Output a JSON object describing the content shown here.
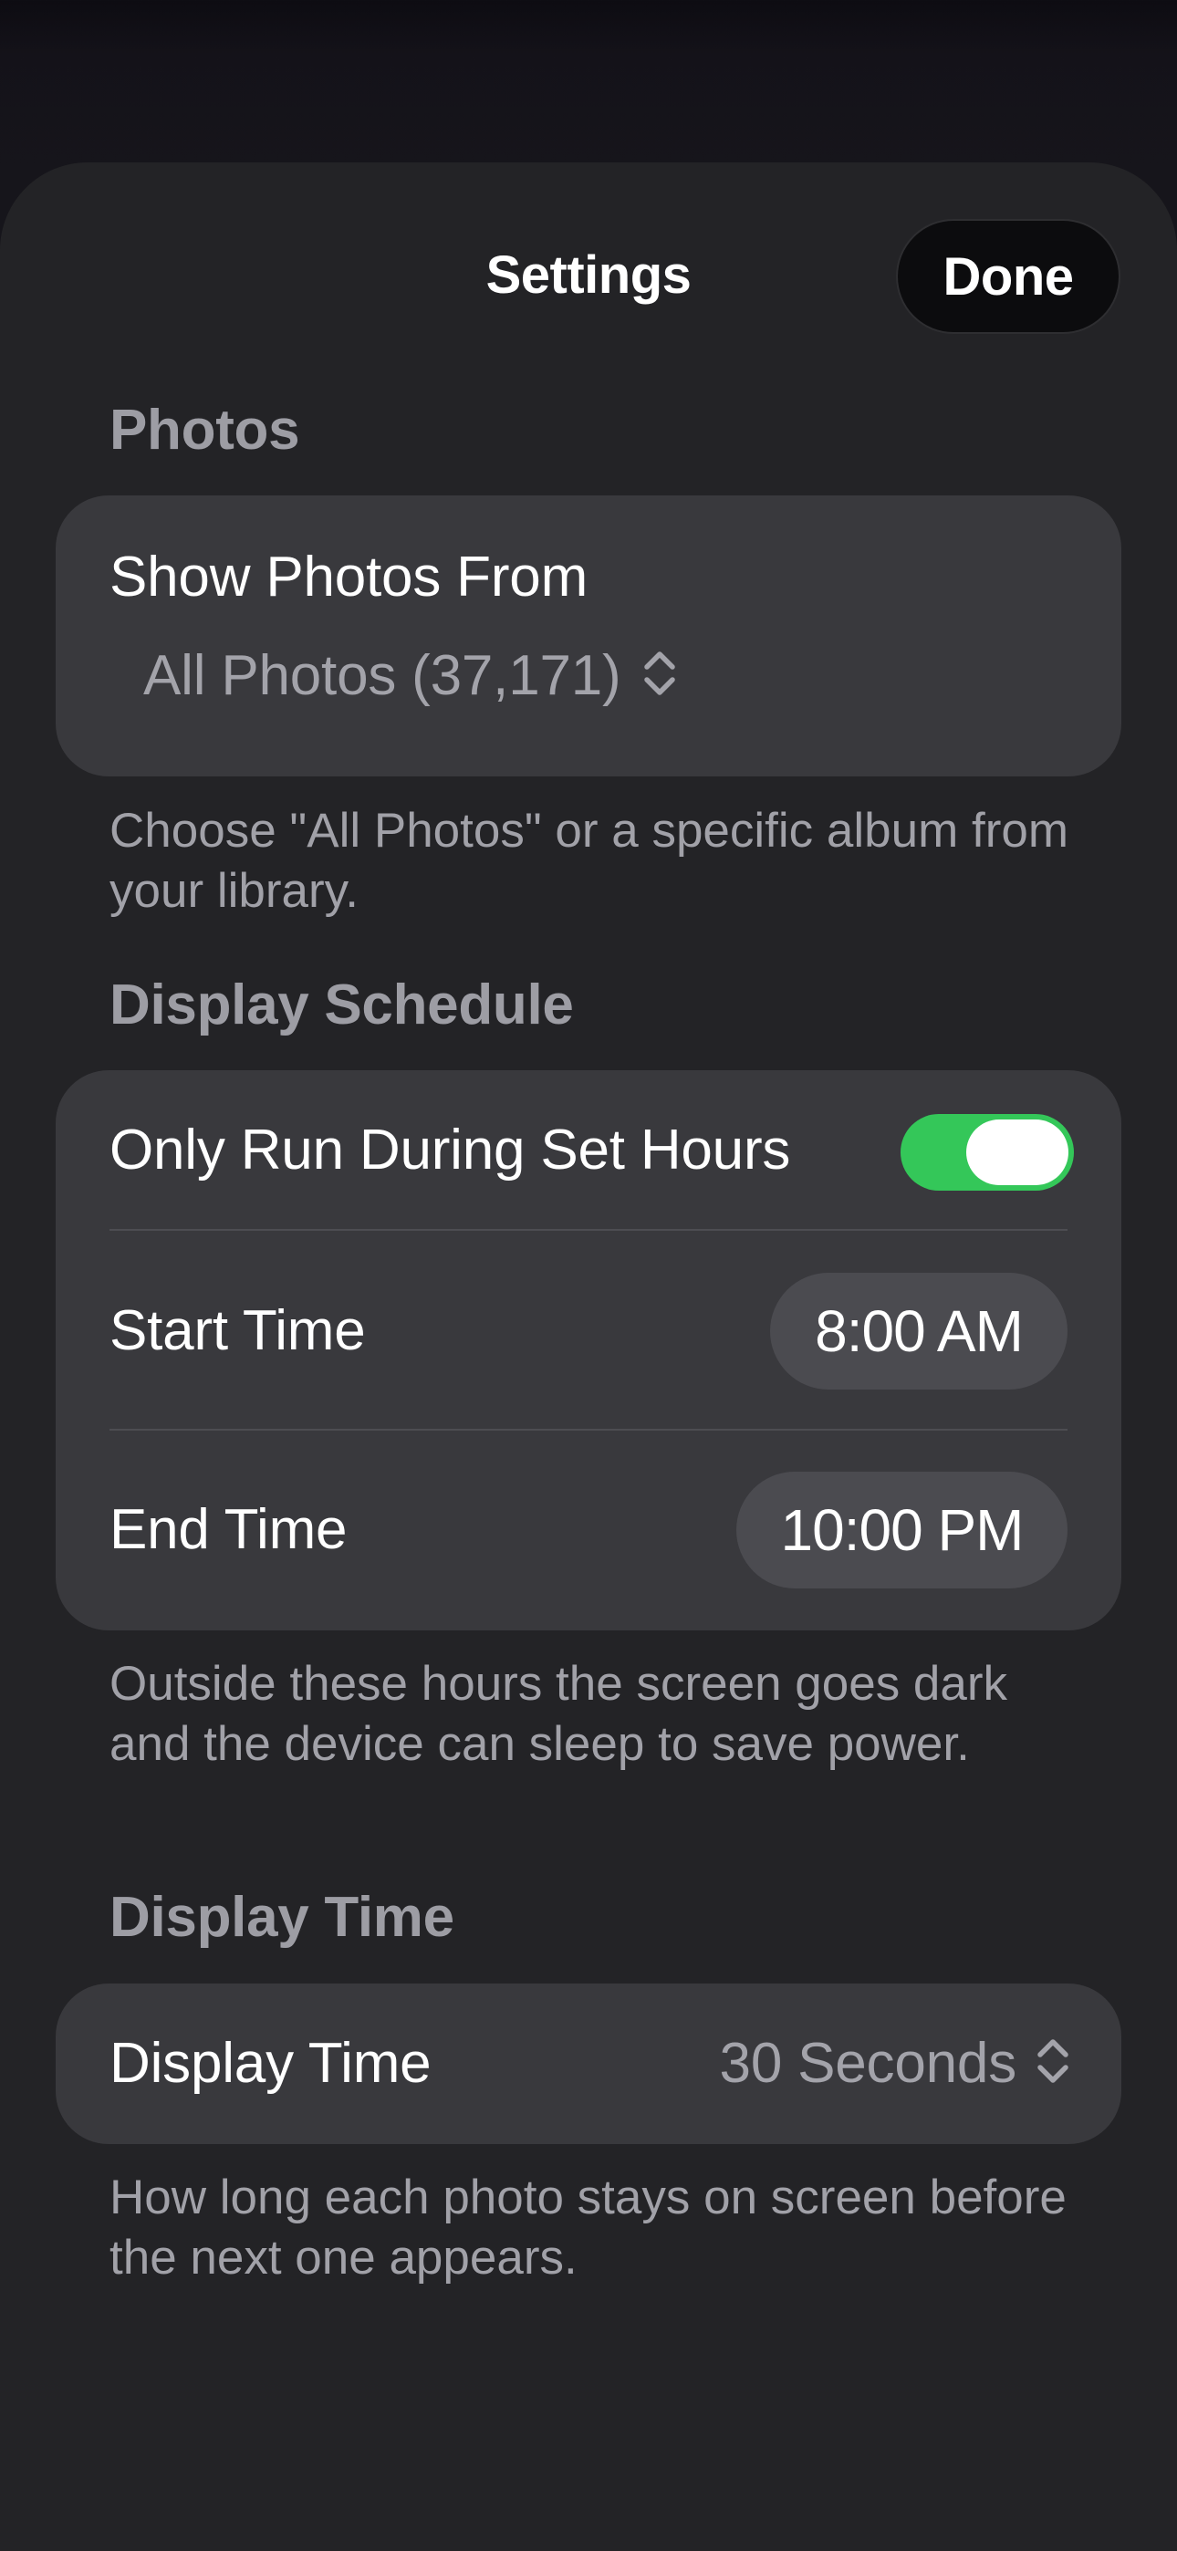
{
  "header": {
    "title": "Settings",
    "done_label": "Done"
  },
  "photos_section": {
    "label": "Photos",
    "show_photos_from_label": "Show Photos From",
    "show_photos_from_value": "All Photos (37,171)",
    "footnote": "Choose \"All Photos\" or a specific album from your library."
  },
  "schedule_section": {
    "label": "Display Schedule",
    "only_run_label": "Only Run During Set Hours",
    "only_run_enabled": true,
    "start_time_label": "Start Time",
    "start_time_value": "8:00 AM",
    "end_time_label": "End Time",
    "end_time_value": "10:00 PM",
    "footnote": "Outside these hours the screen goes dark and the device can sleep to save power."
  },
  "display_time_section": {
    "label": "Display Time",
    "row_label": "Display Time",
    "value": "30 Seconds",
    "footnote": "How long each photo stays on screen before the next one appears."
  },
  "icons": {
    "picker": "chevron-up-down-icon"
  },
  "colors": {
    "toggle_on": "#34c759",
    "sheet_background": "#232326",
    "card_background": "#39393d"
  }
}
